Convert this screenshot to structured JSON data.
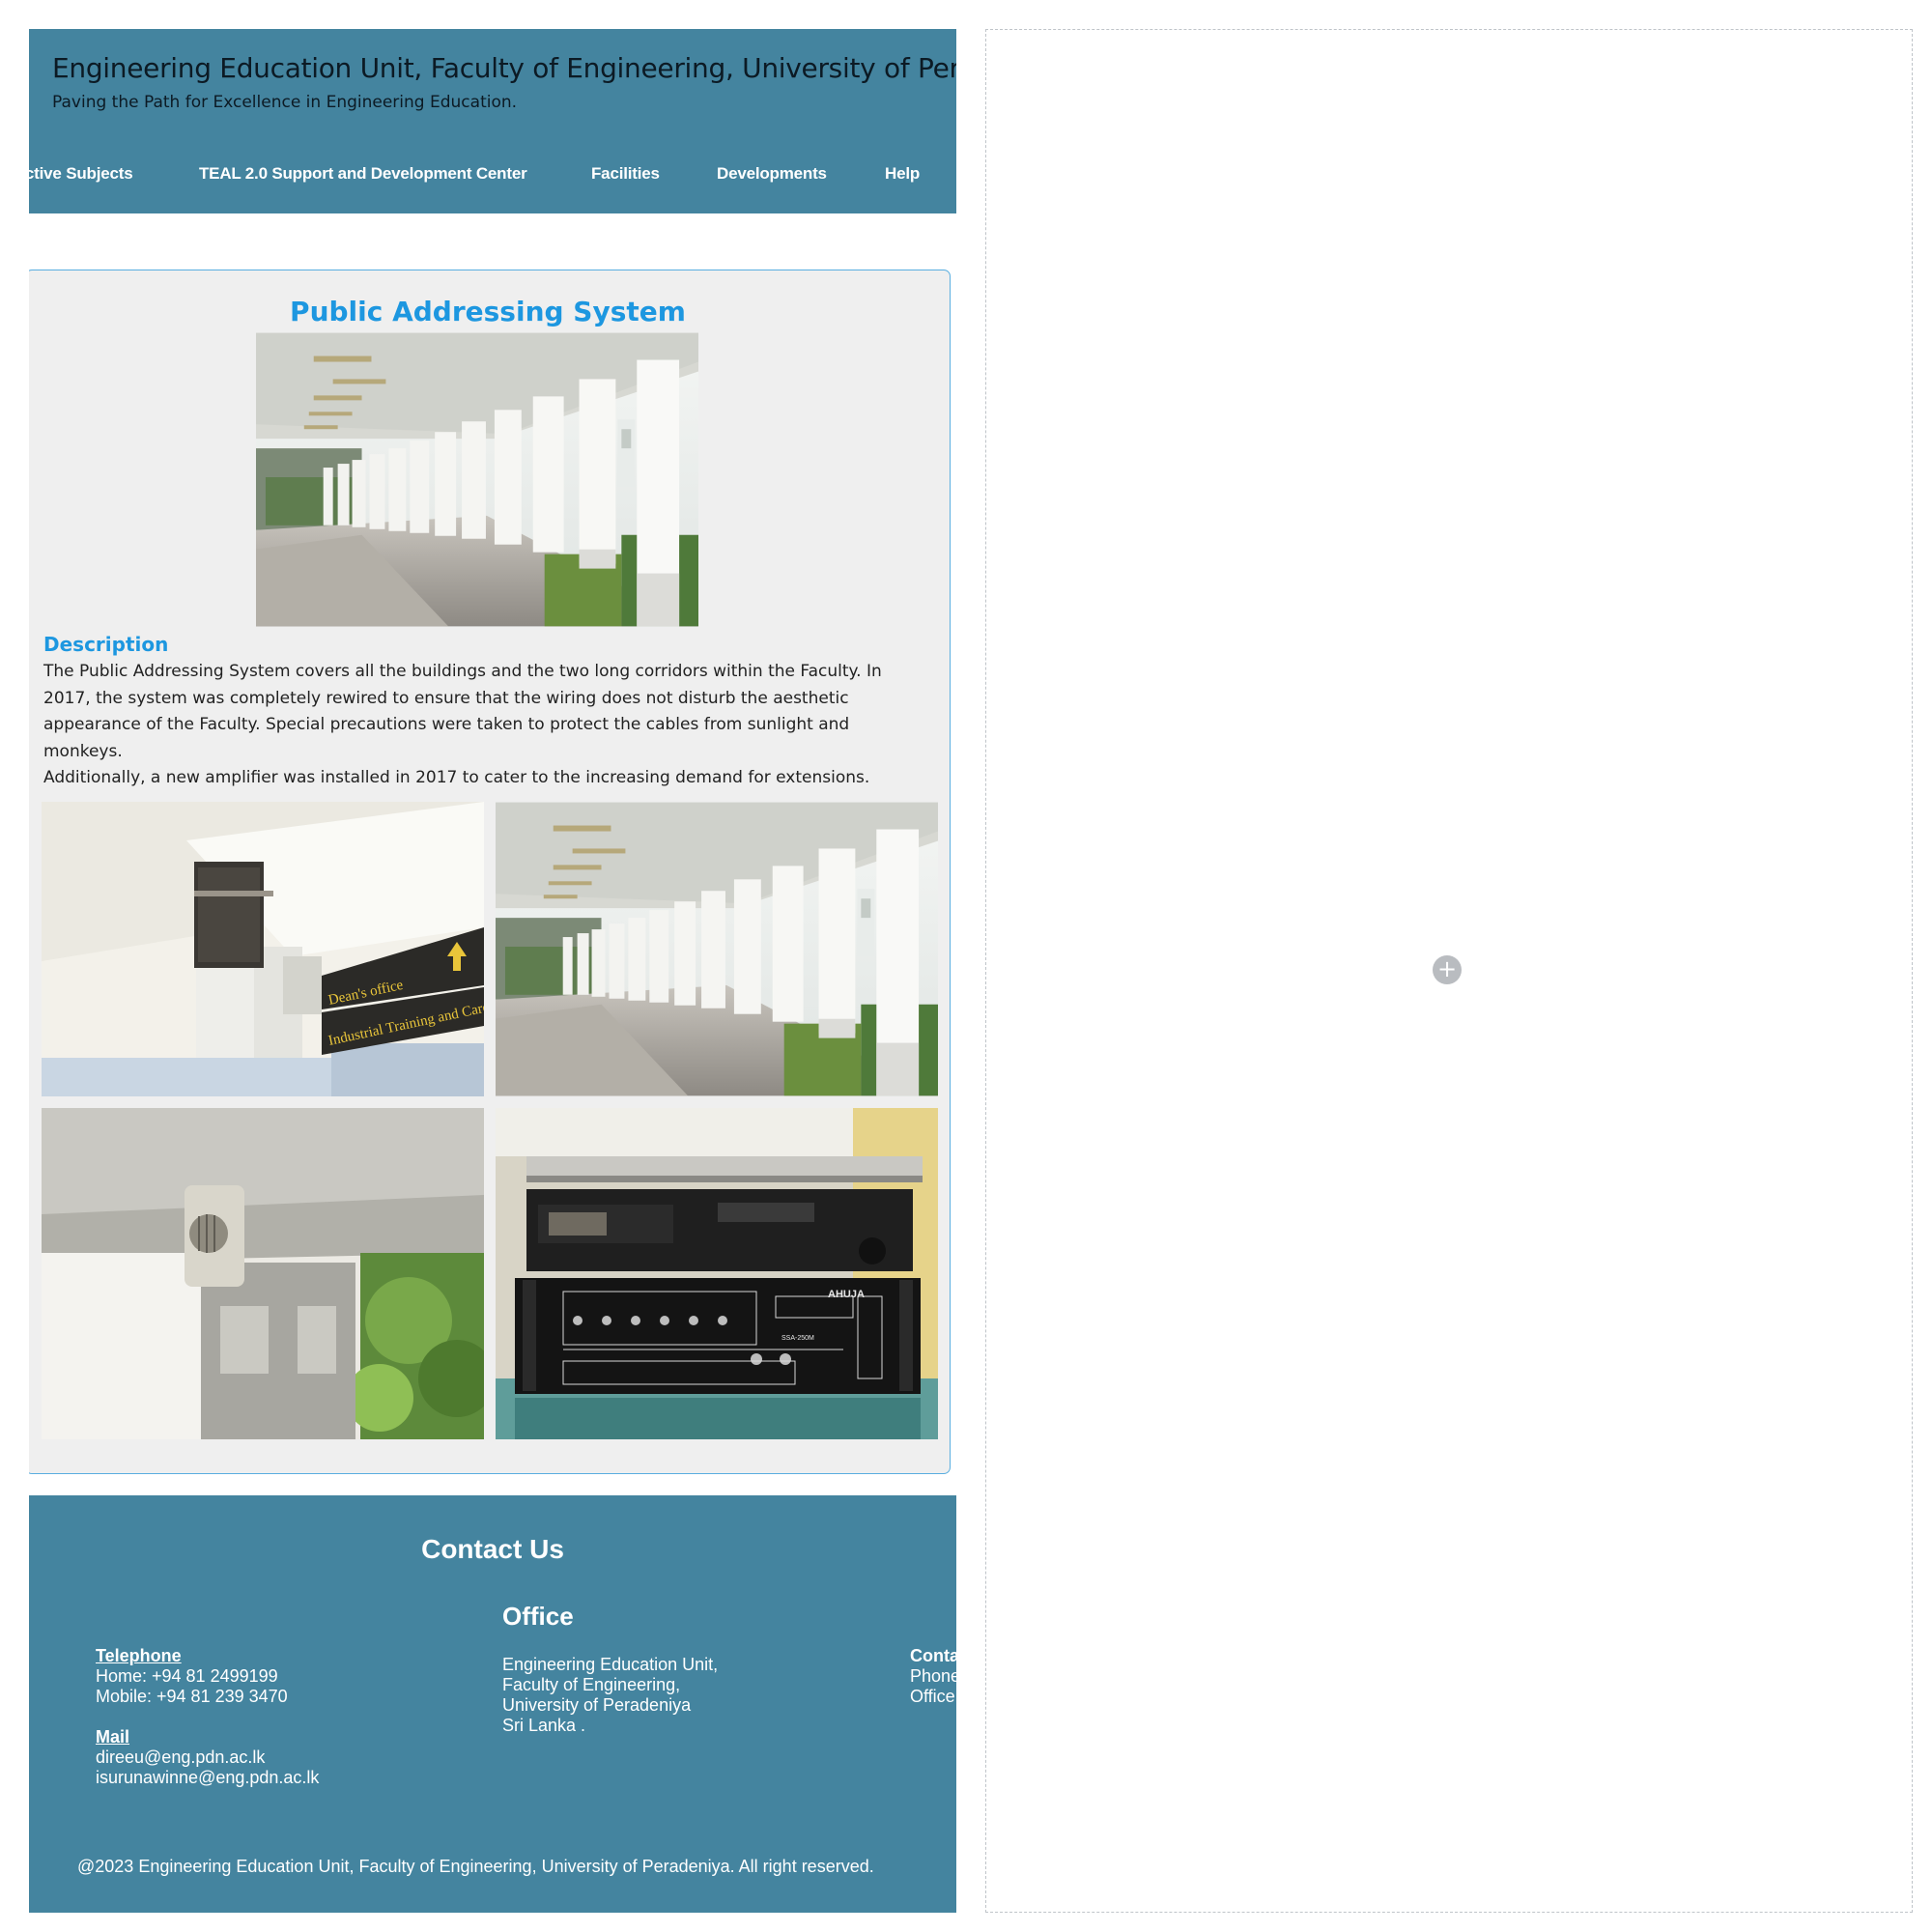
{
  "header": {
    "title": "Engineering Education Unit, Faculty of Engineering, University of Peradeniya",
    "tagline": "Paving the Path for Excellence in Engineering Education.",
    "nav": [
      "Elective Subjects",
      "TEAL 2.0 Support and Development Center",
      "Facilities",
      "Developments",
      "Help"
    ]
  },
  "main": {
    "title": "Public Addressing System",
    "description_heading": "Description",
    "description_p1": "The Public Addressing System covers all the buildings and the two long corridors within the Faculty. In 2017, the system was completely rewired to ensure that the wiring does not disturb the aesthetic appearance of the Faculty. Special precautions were taken to protect the cables from sunlight and monkeys.",
    "description_p2": "Additionally, a new amplifier was installed in 2017 to cater to the increasing demand for extensions.",
    "photo_signs": {
      "line1": "Dean's office",
      "line2": "Industrial Training and Career"
    },
    "amp_brand": "AHUJA",
    "amp_model": "SSA-250M"
  },
  "footer": {
    "heading": "Contact Us",
    "telephone_label": "Telephone",
    "home": "Home: +94 81 2499199",
    "mobile": "Mobile: +94 81 239 3470",
    "mail_label": "Mail",
    "email1": "direeu@eng.pdn.ac.lk",
    "email2": "isurunawinne@eng.pdn.ac.lk",
    "office_heading": "Office",
    "office_lines": [
      "Engineering Education Unit,",
      "Faculty of Engineering,",
      "University of Peradeniya",
      "Sri Lanka ."
    ],
    "contact_cut": {
      "label": "Contact",
      "line1": "Phone",
      "line2": "Office"
    },
    "copyright": "@2023 Engineering Education Unit, Faculty of Engineering, University of Peradeniya. All right reserved."
  },
  "panel": {
    "add_symbol": "+"
  },
  "colors": {
    "header_bg": "#44849f",
    "accent_blue": "#1d97e0",
    "card_bg": "#efefef"
  }
}
